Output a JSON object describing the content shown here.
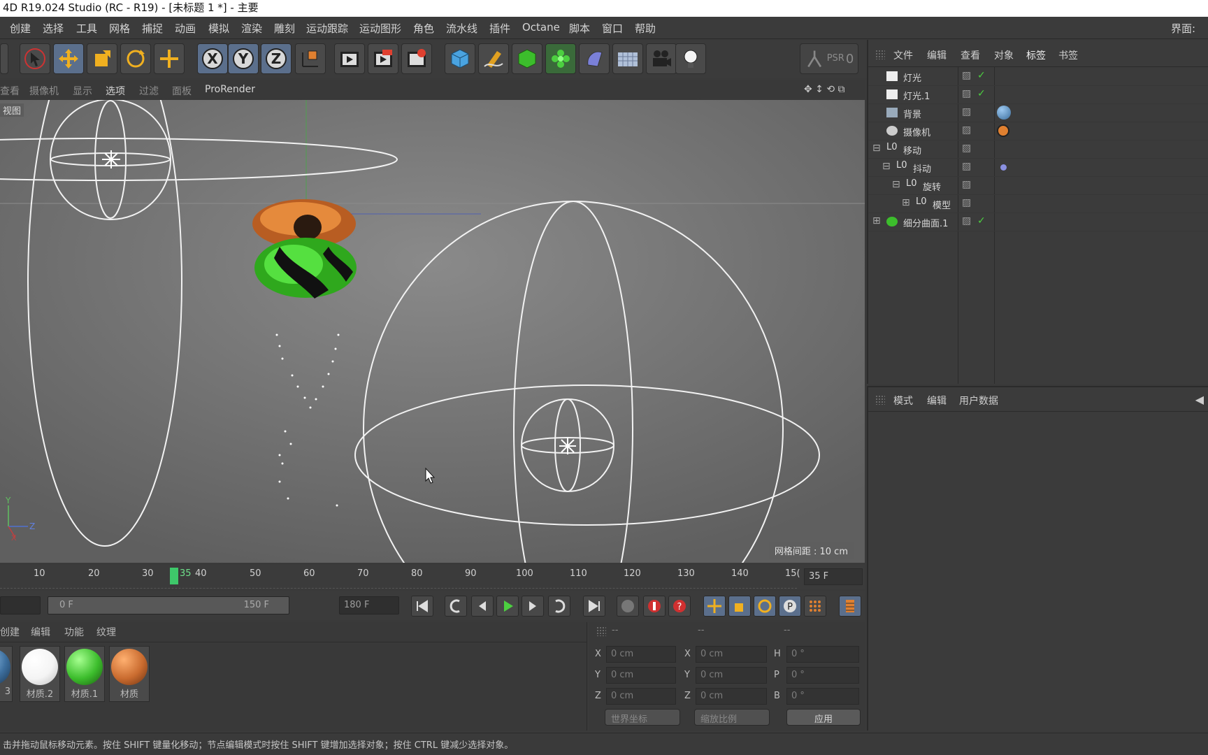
{
  "window": {
    "title": "4D R19.024 Studio (RC - R19) - [未标题 1 *] - 主要"
  },
  "menubar": {
    "items": [
      "创建",
      "选择",
      "工具",
      "网格",
      "捕捉",
      "动画",
      "模拟",
      "渲染",
      "雕刻",
      "运动跟踪",
      "运动图形",
      "角色",
      "流水线",
      "插件",
      "Octane",
      "脚本",
      "窗口",
      "帮助"
    ],
    "right_label": "界面:"
  },
  "toolbar": {
    "icons": [
      "pointer-icon",
      "move-icon",
      "scale-icon",
      "rotate-icon",
      "transform-icon",
      "x-axis-icon",
      "y-axis-icon",
      "z-axis-icon",
      "coordinate-system-icon",
      "render-view-icon",
      "render-picture-viewer-icon",
      "render-settings-icon",
      "cube-icon",
      "pen-icon",
      "subdivision-icon",
      "cloner-icon",
      "deformer-icon",
      "floor-icon",
      "camera-icon",
      "light-icon",
      "psr-icon"
    ],
    "psr_label": "PSR",
    "psr_value": "0"
  },
  "viewport_menu": {
    "items": [
      "查看",
      "摄像机",
      "显示",
      "选项",
      "过滤",
      "面板"
    ],
    "selected": "选项",
    "renderer": "ProRender"
  },
  "viewport": {
    "label": "视图",
    "grid_spacing": "网格间距 : 10 cm",
    "axis_y": "Y",
    "axis_z": "Z",
    "axis_x": "X"
  },
  "timeline": {
    "ticks": [
      "10",
      "20",
      "30",
      "40",
      "50",
      "60",
      "70",
      "80",
      "90",
      "100",
      "110",
      "120",
      "130",
      "140",
      "15("
    ],
    "current_frame_marker": "35",
    "current_frame": "35 F"
  },
  "transport": {
    "start_field": "0 F",
    "range_start": "0 F",
    "range_end": "150 F",
    "end_field": "180 F"
  },
  "materials": {
    "tabs": [
      "创建",
      "编辑",
      "功能",
      "纹理"
    ],
    "items": [
      {
        "label": "3",
        "color": "#3d6f9e"
      },
      {
        "label": "材质.2",
        "color": "#f4f4f4"
      },
      {
        "label": "材质.1",
        "color": "#3cbd2c"
      },
      {
        "label": "材质",
        "color": "#c96b2f"
      }
    ]
  },
  "coordinates": {
    "headers": [
      "--",
      "--",
      "--"
    ],
    "rows": [
      {
        "l1": "X",
        "v1": "0 cm",
        "l2": "X",
        "v2": "0 cm",
        "l3": "H",
        "v3": "0 °"
      },
      {
        "l1": "Y",
        "v1": "0 cm",
        "l2": "Y",
        "v2": "0 cm",
        "l3": "P",
        "v3": "0 °"
      },
      {
        "l1": "Z",
        "v1": "0 cm",
        "l2": "Z",
        "v2": "0 cm",
        "l3": "B",
        "v3": "0 °"
      }
    ],
    "world_dropdown": "世界坐标",
    "scale_dropdown": "缩放比例",
    "apply_button": "应用"
  },
  "object_manager": {
    "tabs": [
      "文件",
      "编辑",
      "查看",
      "对象",
      "标签",
      "书签"
    ],
    "active_tab": "标签",
    "objects": [
      {
        "name": "灯光",
        "indent": 0,
        "icon": "light-object-icon"
      },
      {
        "name": "灯光.1",
        "indent": 0,
        "icon": "light-object-icon"
      },
      {
        "name": "背景",
        "indent": 0,
        "icon": "background-object-icon"
      },
      {
        "name": "摄像机",
        "indent": 0,
        "icon": "camera-object-icon"
      },
      {
        "name": "移动",
        "indent": 0,
        "icon": "null-object-icon"
      },
      {
        "name": "抖动",
        "indent": 1,
        "icon": "null-object-icon"
      },
      {
        "name": "旋转",
        "indent": 2,
        "icon": "null-object-icon"
      },
      {
        "name": "模型",
        "indent": 3,
        "icon": "null-object-icon"
      },
      {
        "name": "细分曲面.1",
        "indent": 0,
        "icon": "subdivision-object-icon"
      }
    ]
  },
  "attribute_manager": {
    "tabs": [
      "模式",
      "编辑",
      "用户数据"
    ]
  },
  "statusbar": {
    "text": "击并拖动鼠标移动元素。按住 SHIFT 键量化移动；节点编辑模式时按住 SHIFT 键增加选择对象；按住 CTRL 键减少选择对象。"
  }
}
